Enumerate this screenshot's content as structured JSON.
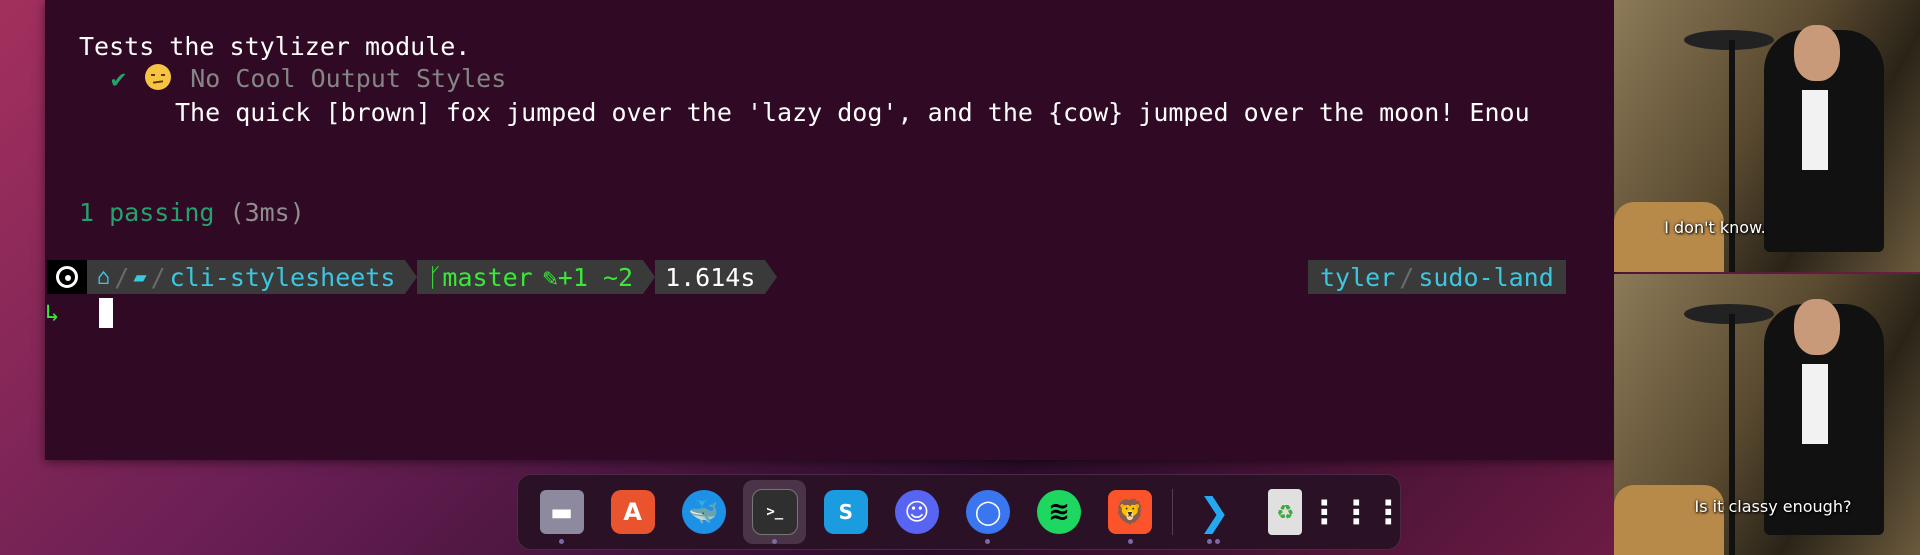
{
  "terminal": {
    "test_title": "Tests the stylizer module.",
    "check": "✔",
    "test_name": "No Cool Output Styles",
    "test_output": "The quick [brown] fox jumped over the 'lazy dog', and the {cow} jumped over the moon! Enou",
    "passing_label": "1 passing",
    "passing_time": "(3ms)"
  },
  "prompt": {
    "os_icon": "ubuntu-icon",
    "home_icon": "⌂",
    "folder_icon": "▰",
    "directory": "cli-stylesheets",
    "branch_icon": "ᚴ",
    "branch": "master",
    "edit_icon": "✎",
    "changes": "+1 ~2",
    "duration": "1.614s",
    "user": "tyler",
    "host": "sudo-land",
    "continuation_arrow": "↳"
  },
  "meme": {
    "top_caption": "I don't know.",
    "bottom_caption": "Is it classy enough?"
  },
  "dock": {
    "items": [
      {
        "name": "files",
        "glyph": "▬"
      },
      {
        "name": "app-center",
        "glyph": "A"
      },
      {
        "name": "docker",
        "glyph": "🐳"
      },
      {
        "name": "terminal",
        "glyph": ">_"
      },
      {
        "name": "sendit",
        "glyph": "S"
      },
      {
        "name": "discord",
        "glyph": "☺"
      },
      {
        "name": "signal",
        "glyph": "◯"
      },
      {
        "name": "spotify",
        "glyph": "≋"
      },
      {
        "name": "brave",
        "glyph": "🦁"
      },
      {
        "name": "vscode",
        "glyph": "❯"
      },
      {
        "name": "trash",
        "glyph": "♻"
      },
      {
        "name": "show-apps",
        "glyph": "⋮⋮⋮"
      }
    ]
  },
  "colors": {
    "terminal_bg": "#300a24",
    "pass_green": "#22a36b",
    "prompt_cyan": "#3cc7e0",
    "git_green": "#39e839"
  }
}
